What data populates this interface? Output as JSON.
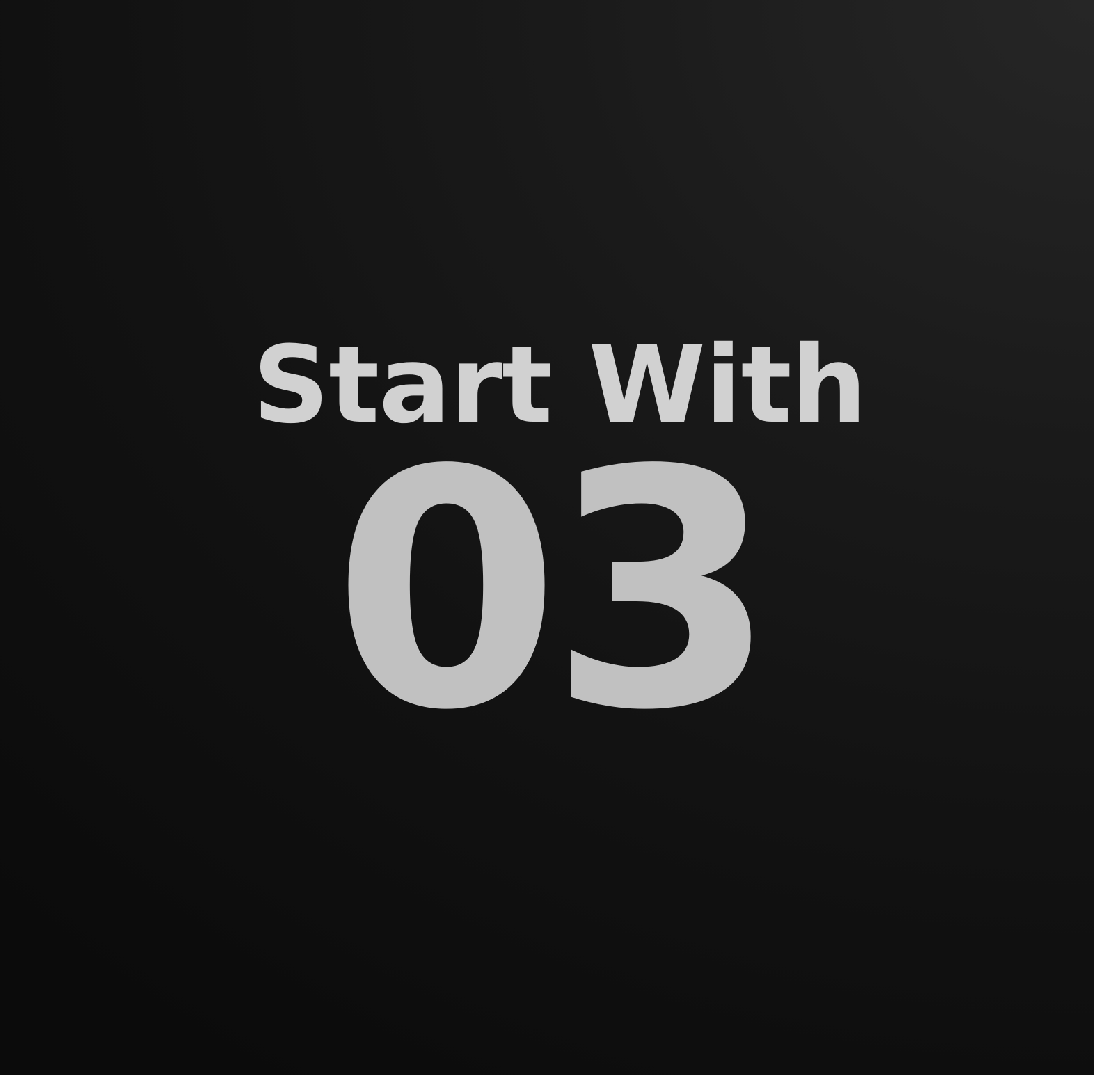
{
  "headline": "Start With",
  "number": "03",
  "colors": {
    "background": "#121212",
    "headline_text": "#d1d1d1",
    "number_text": "#c1c1c1"
  }
}
